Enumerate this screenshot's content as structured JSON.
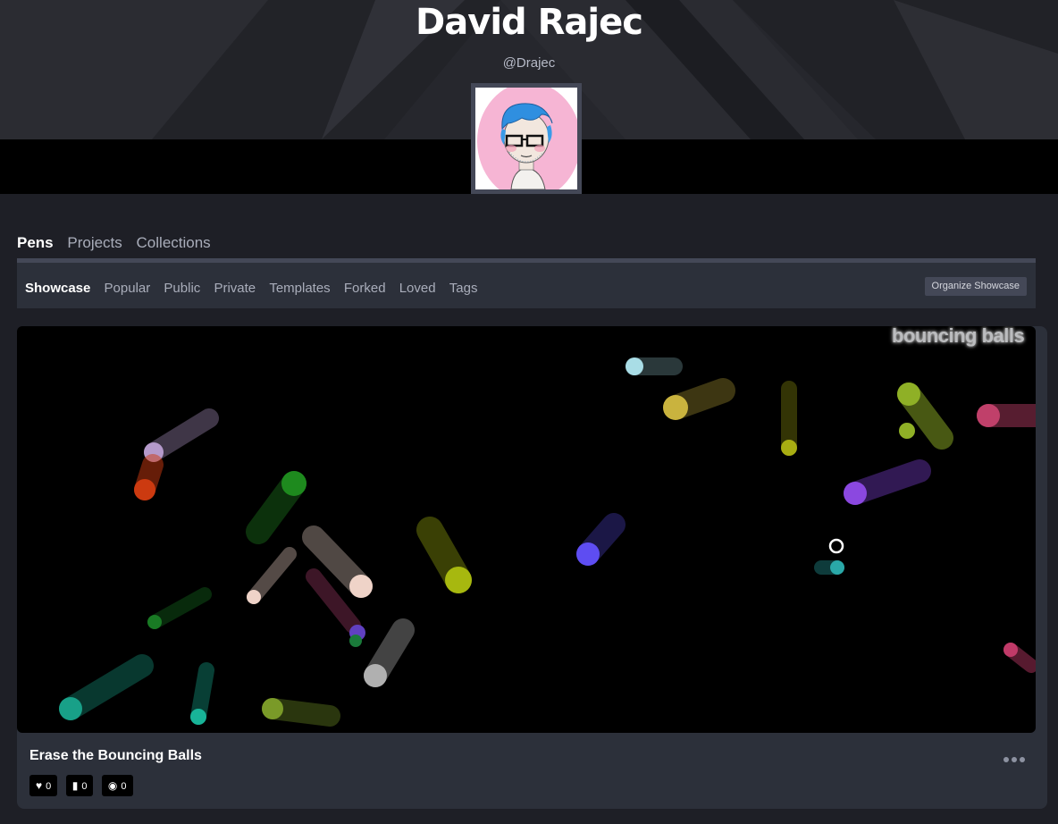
{
  "profile": {
    "name": "David Rajec",
    "handle": "@Drajec"
  },
  "tabs": [
    {
      "label": "Pens",
      "active": true
    },
    {
      "label": "Projects",
      "active": false
    },
    {
      "label": "Collections",
      "active": false
    }
  ],
  "subnav": {
    "items": [
      {
        "label": "Showcase",
        "active": true
      },
      {
        "label": "Popular",
        "active": false
      },
      {
        "label": "Public",
        "active": false
      },
      {
        "label": "Private",
        "active": false
      },
      {
        "label": "Templates",
        "active": false
      },
      {
        "label": "Forked",
        "active": false
      },
      {
        "label": "Loved",
        "active": false
      },
      {
        "label": "Tags",
        "active": false
      }
    ],
    "organize_label": "Organize Showcase"
  },
  "pen": {
    "preview_title": "bouncing balls",
    "title": "Erase the Bouncing Balls",
    "likes": "0",
    "comments": "0",
    "views": "0"
  },
  "icons": {
    "like": "heart-icon",
    "comment": "comment-icon",
    "view": "eye-icon",
    "more": "more-dots-icon"
  }
}
